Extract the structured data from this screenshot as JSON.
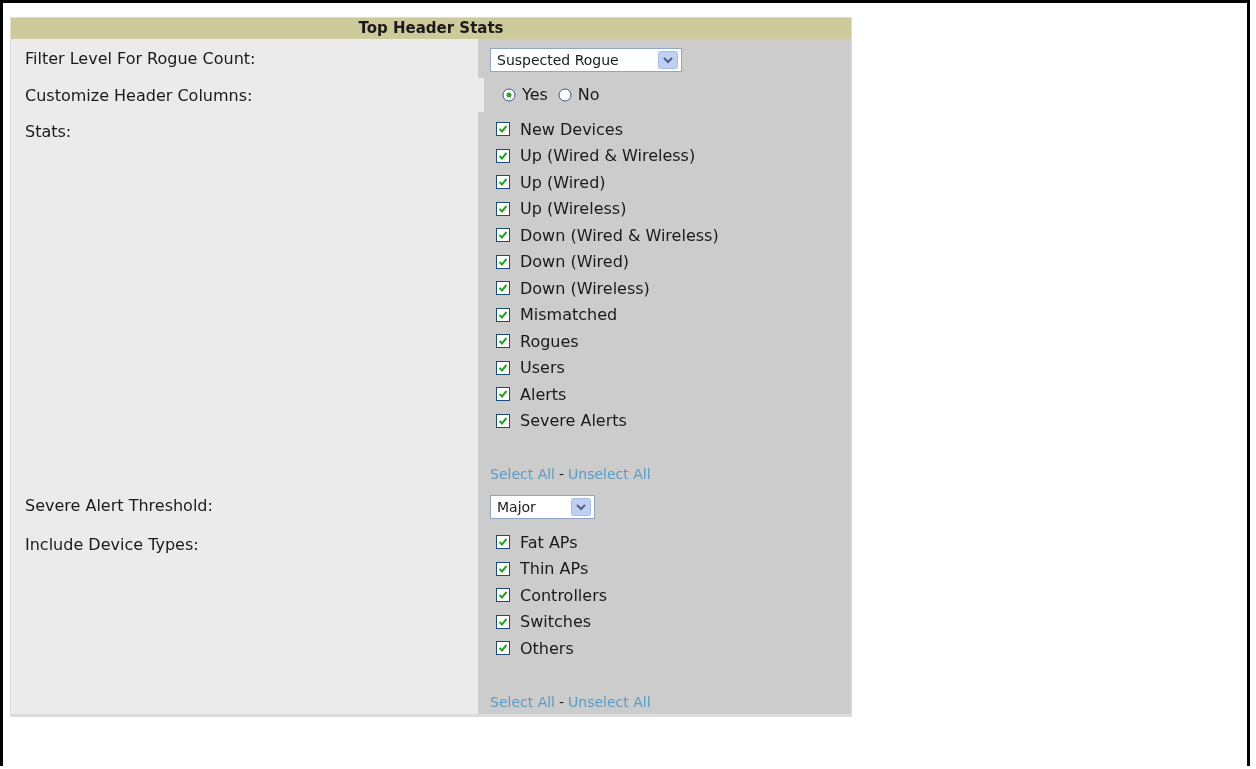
{
  "title": "Top Header Stats",
  "rows": [
    {
      "kind": "select",
      "label": "Filter Level For Rogue Count:",
      "value": "Suspected Rogue"
    },
    {
      "kind": "radio",
      "label": "Customize Header Columns:",
      "options": [
        {
          "label": "Yes",
          "selected": true
        },
        {
          "label": "No",
          "selected": false
        }
      ]
    },
    {
      "kind": "checklist",
      "label": "Stats:",
      "items": [
        {
          "label": "New Devices",
          "checked": true
        },
        {
          "label": "Up (Wired & Wireless)",
          "checked": true
        },
        {
          "label": "Up (Wired)",
          "checked": true
        },
        {
          "label": "Up (Wireless)",
          "checked": true
        },
        {
          "label": "Down (Wired & Wireless)",
          "checked": true
        },
        {
          "label": "Down (Wired)",
          "checked": true
        },
        {
          "label": "Down (Wireless)",
          "checked": true
        },
        {
          "label": "Mismatched",
          "checked": true
        },
        {
          "label": "Rogues",
          "checked": true
        },
        {
          "label": "Users",
          "checked": true
        },
        {
          "label": "Alerts",
          "checked": true
        },
        {
          "label": "Severe Alerts",
          "checked": true
        }
      ],
      "select_all": "Select All",
      "separator": "-",
      "unselect_all": "Unselect All"
    },
    {
      "kind": "select",
      "label": "Severe Alert Threshold:",
      "value": "Major"
    },
    {
      "kind": "checklist",
      "label": "Include Device Types:",
      "items": [
        {
          "label": "Fat APs",
          "checked": true
        },
        {
          "label": "Thin APs",
          "checked": true
        },
        {
          "label": "Controllers",
          "checked": true
        },
        {
          "label": "Switches",
          "checked": true
        },
        {
          "label": "Others",
          "checked": true
        }
      ],
      "select_all": "Select All",
      "separator": "-",
      "unselect_all": "Unselect All"
    }
  ]
}
